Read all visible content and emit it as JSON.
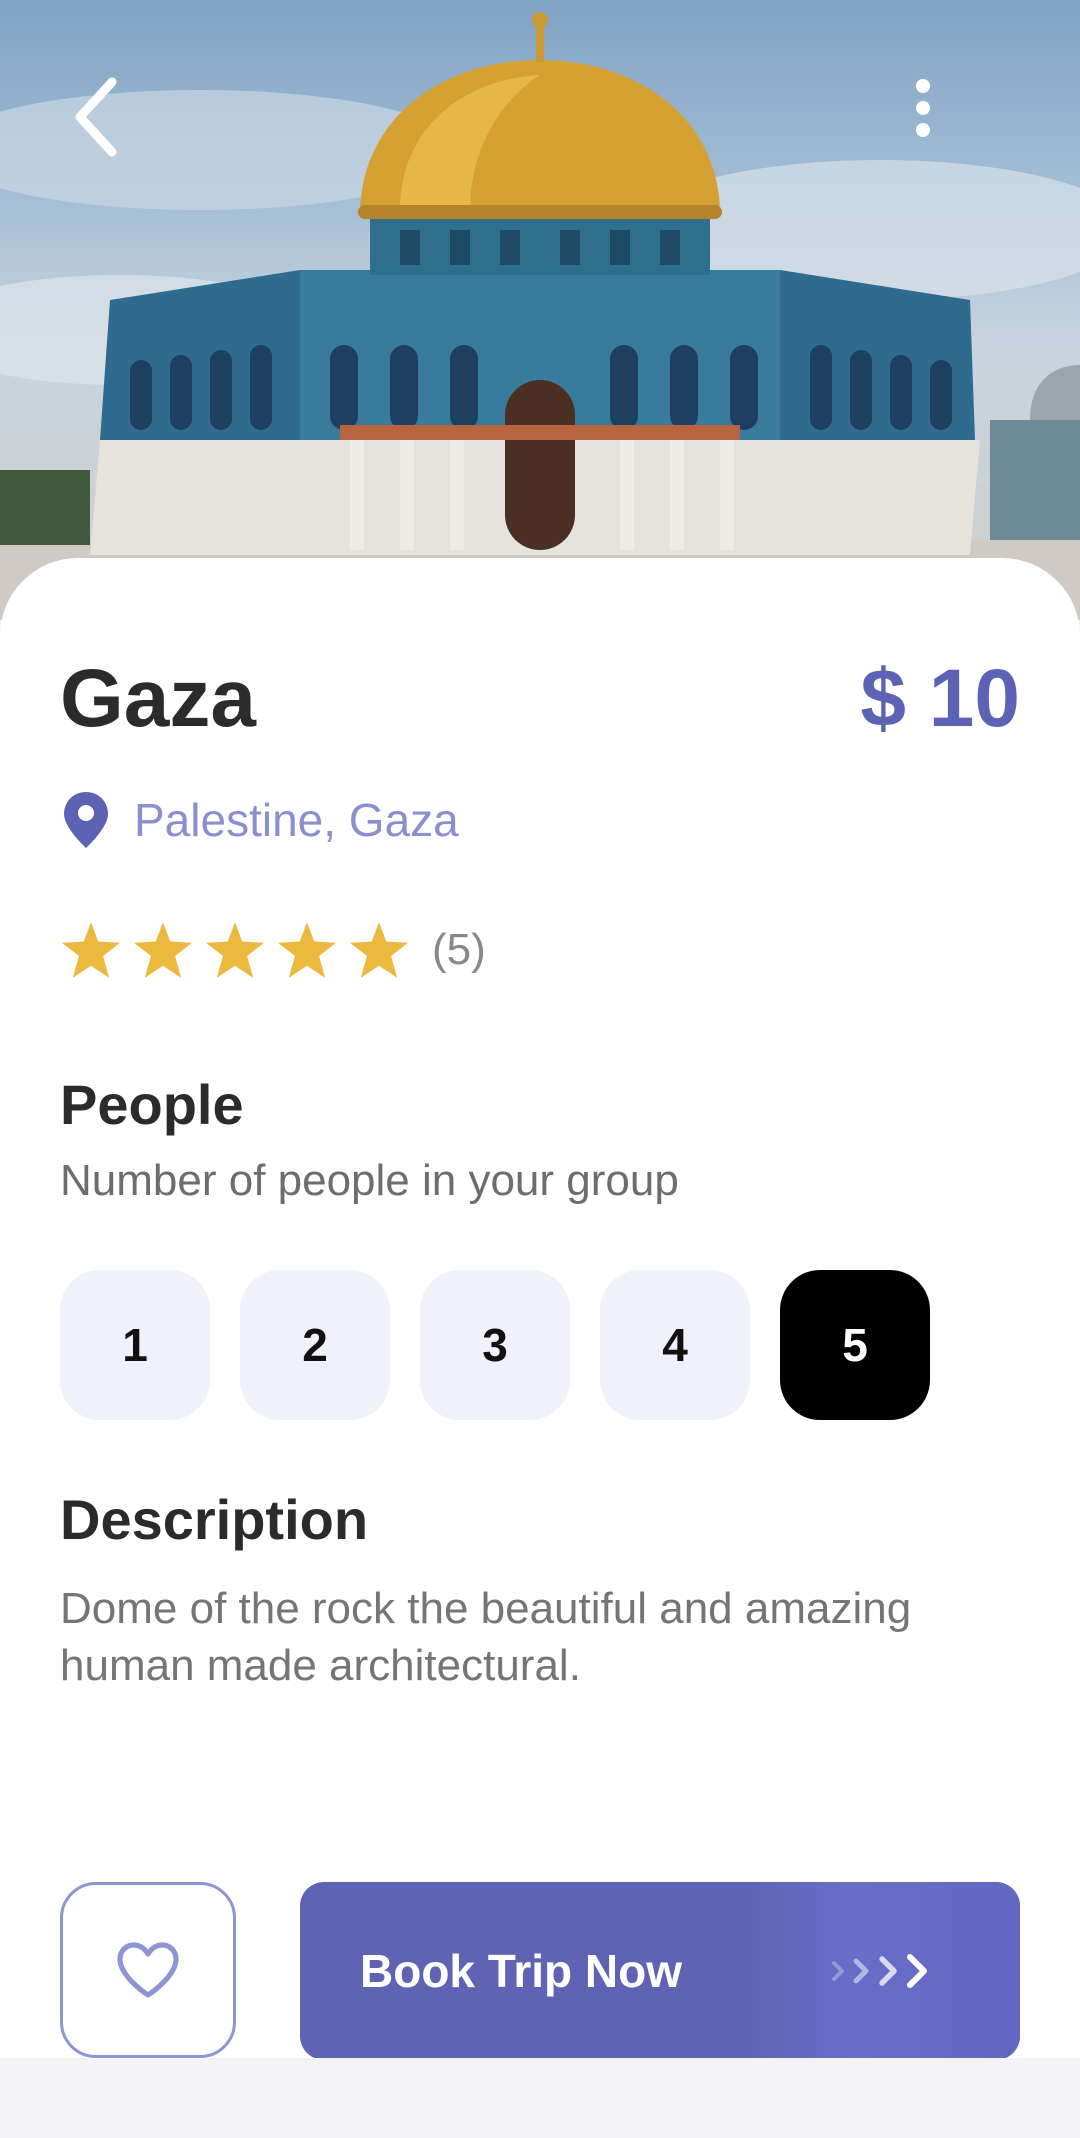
{
  "place": {
    "title": "Gaza",
    "price": "$ 10",
    "location": "Palestine, Gaza",
    "rating_value": 5,
    "rating_count": "(5)"
  },
  "people": {
    "title": "People",
    "subtitle": "Number of people in your group",
    "options": [
      "1",
      "2",
      "3",
      "4",
      "5"
    ],
    "selected": "5"
  },
  "description": {
    "title": "Description",
    "text": "Dome of the rock the beautiful and amazing human made architectural."
  },
  "actions": {
    "book_label": "Book Trip Now"
  },
  "icons": {
    "back": "chevron-left-icon",
    "more": "more-vertical-icon",
    "location": "map-pin-icon",
    "star": "star-icon",
    "favorite": "heart-icon",
    "arrows": "chevrons-right-icon"
  },
  "colors": {
    "accent": "#5e63b3",
    "accent_light": "#8a8fd0",
    "star": "#eab93d",
    "selected_bg": "#000000",
    "option_bg": "#f0f1fa"
  }
}
